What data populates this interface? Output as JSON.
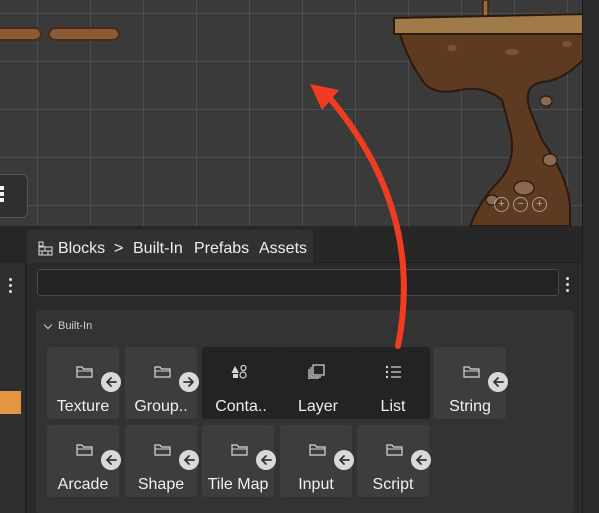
{
  "tabs": {
    "blocks": "Blocks",
    "separator": ">",
    "built_in": "Built-In",
    "prefabs": "Prefabs",
    "assets": "Assets"
  },
  "search": {
    "value": "",
    "placeholder": ""
  },
  "group": {
    "title": "Built-In"
  },
  "tiles": [
    {
      "label": "Texture",
      "icon": "folder-icon",
      "badge": "arrow-left"
    },
    {
      "label": "Group..",
      "icon": "folder-icon",
      "badge": "arrow-right"
    },
    {
      "label": "Conta..",
      "icon": "shapes-icon",
      "badge": ""
    },
    {
      "label": "Layer",
      "icon": "layers-icon",
      "badge": ""
    },
    {
      "label": "List",
      "icon": "list-icon",
      "badge": ""
    },
    {
      "label": "String",
      "icon": "folder-icon",
      "badge": "arrow-left"
    },
    {
      "label": "Arcade",
      "icon": "folder-icon",
      "badge": "arrow-left"
    },
    {
      "label": "Shape",
      "icon": "folder-icon",
      "badge": "arrow-left"
    },
    {
      "label": "Tile Map",
      "icon": "folder-icon",
      "badge": "arrow-left"
    },
    {
      "label": "Input",
      "icon": "folder-icon",
      "badge": "arrow-left"
    },
    {
      "label": "Script",
      "icon": "folder-icon",
      "badge": "arrow-left"
    }
  ],
  "scene_zoom": [
    "+",
    "−",
    "+"
  ],
  "colors": {
    "annotation_arrow": "#f23c22",
    "accent_orange": "#e69542",
    "ground_brown": "#5e3a22"
  }
}
